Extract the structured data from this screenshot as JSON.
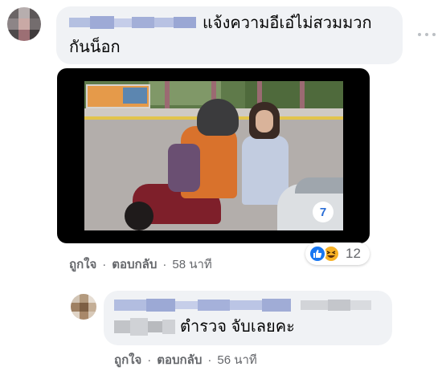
{
  "comment1": {
    "text_line1": "แจ้งความอีเอ๋ไม่สวมมวก",
    "text_line2": "กันน็อก",
    "actions": {
      "like": "ถูกใจ",
      "reply": "ตอบกลับ",
      "time": "58 นาที"
    },
    "reactions": {
      "icons": [
        "like-icon",
        "haha-icon"
      ],
      "count": "12"
    },
    "video": {
      "channel_logo": "7"
    }
  },
  "comment2": {
    "text": "ตำรวจ จับเลยคะ",
    "actions": {
      "like": "ถูกใจ",
      "reply": "ตอบกลับ",
      "time": "56 นาที"
    }
  },
  "colors": {
    "bubble": "#f0f2f5",
    "meta_text": "#65676b",
    "like_blue": "#1877f2",
    "haha_yellow": "#f7b125"
  },
  "separator": "·"
}
